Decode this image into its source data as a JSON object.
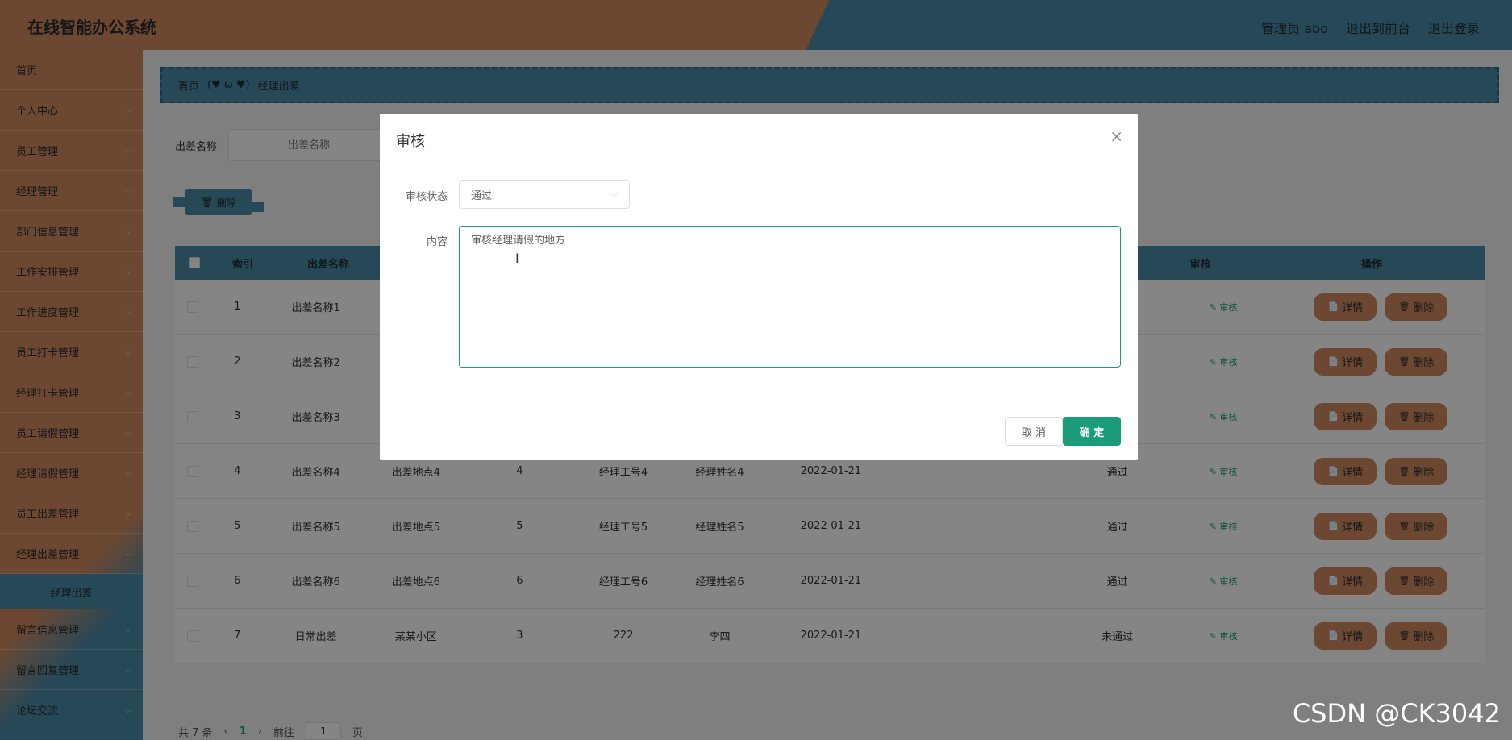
{
  "header": {
    "title": "在线智能办公系统",
    "admin": "管理员 abo",
    "frontend": "退出到前台",
    "logout": "退出登录"
  },
  "sidebar": {
    "items": [
      {
        "label": "首页",
        "chevron": false
      },
      {
        "label": "个人中心",
        "chevron": true
      },
      {
        "label": "员工管理",
        "chevron": true
      },
      {
        "label": "经理管理",
        "chevron": true
      },
      {
        "label": "部门信息管理",
        "chevron": true
      },
      {
        "label": "工作安排管理",
        "chevron": true
      },
      {
        "label": "工作进度管理",
        "chevron": true
      },
      {
        "label": "员工打卡管理",
        "chevron": true
      },
      {
        "label": "经理打卡管理",
        "chevron": true
      },
      {
        "label": "员工请假管理",
        "chevron": true
      },
      {
        "label": "经理请假管理",
        "chevron": true
      },
      {
        "label": "员工出差管理",
        "chevron": true
      },
      {
        "label": "经理出差管理",
        "chevron": true
      }
    ],
    "active_sub": "经理出差",
    "items_after": [
      {
        "label": "留言信息管理"
      },
      {
        "label": "留言回复管理"
      },
      {
        "label": "论坛交流"
      }
    ]
  },
  "breadcrumb": {
    "home": "首页",
    "separator": "(♥ ω ♥)",
    "current": "经理出差"
  },
  "search": {
    "label": "出差名称",
    "placeholder": "出差名称"
  },
  "toolbar": {
    "delete_label": "删除"
  },
  "table": {
    "headers": [
      "索引",
      "出差名称",
      "",
      "",
      "",
      "",
      "",
      "",
      "审核",
      "操作"
    ],
    "rows": [
      {
        "index": "1",
        "name": "出差名称1",
        "place": "",
        "days": "",
        "job_no": "",
        "mgr_name": "",
        "date": "",
        "status": ""
      },
      {
        "index": "2",
        "name": "出差名称2",
        "place": "",
        "days": "",
        "job_no": "",
        "mgr_name": "",
        "date": "",
        "status": ""
      },
      {
        "index": "3",
        "name": "出差名称3",
        "place": "",
        "days": "",
        "job_no": "",
        "mgr_name": "",
        "date": "",
        "status": ""
      },
      {
        "index": "4",
        "name": "出差名称4",
        "place": "出差地点4",
        "days": "4",
        "job_no": "经理工号4",
        "mgr_name": "经理姓名4",
        "date": "2022-01-21",
        "status": "通过"
      },
      {
        "index": "5",
        "name": "出差名称5",
        "place": "出差地点5",
        "days": "5",
        "job_no": "经理工号5",
        "mgr_name": "经理姓名5",
        "date": "2022-01-21",
        "status": "通过"
      },
      {
        "index": "6",
        "name": "出差名称6",
        "place": "出差地点6",
        "days": "6",
        "job_no": "经理工号6",
        "mgr_name": "经理姓名6",
        "date": "2022-01-21",
        "status": "通过"
      },
      {
        "index": "7",
        "name": "日常出差",
        "place": "某某小区",
        "days": "3",
        "job_no": "222",
        "mgr_name": "李四",
        "date": "2022-01-21",
        "status": "未通过"
      }
    ],
    "audit_label": "审核",
    "detail_label": "详情",
    "row_delete_label": "删除"
  },
  "pager": {
    "total": "共 7 条",
    "current_page": "1",
    "goto_label": "前往",
    "goto_value": "1",
    "page_suffix": "页"
  },
  "dialog": {
    "title": "审核",
    "status_label": "审核状态",
    "status_value": "通过",
    "content_label": "内容",
    "content_value": "审核经理请假的地方",
    "cancel": "取 消",
    "ok": "确 定"
  },
  "watermark": "CSDN @CK3042",
  "colors": {
    "accent_orange": "#d08a62",
    "accent_blue": "#4a8aa8",
    "primary_green": "#1a9c7a"
  }
}
